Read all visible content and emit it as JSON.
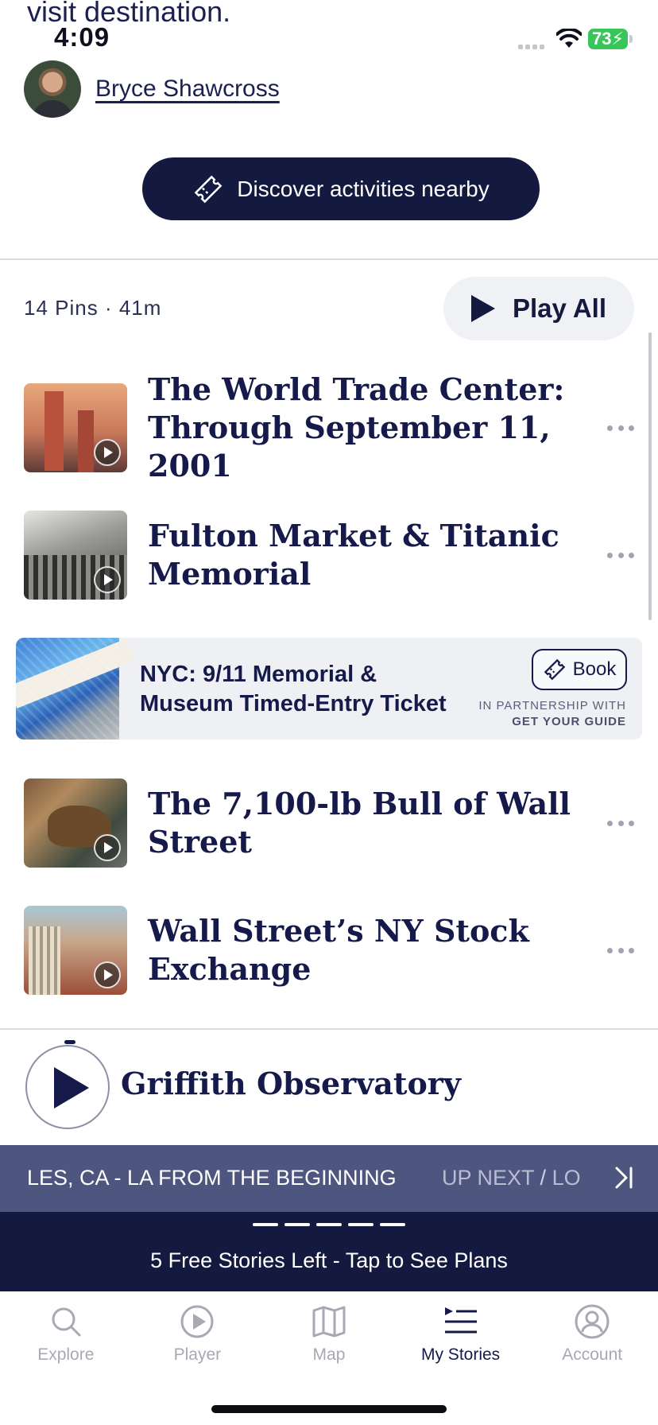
{
  "top_cut_text": "visit destination.",
  "status_bar": {
    "time": "4:09",
    "battery": "73"
  },
  "author": {
    "name": "Bryce Shawcross"
  },
  "discover_button": {
    "label": "Discover activities nearby"
  },
  "playlist": {
    "meta": "14 Pins · 41m",
    "play_all_label": "Play All",
    "pins": [
      {
        "title": "The World Trade Center: Through September 11, 2001"
      },
      {
        "title": "Fulton Market & Titanic Memorial"
      },
      {
        "title": "The 7,100-lb Bull of Wall Street"
      },
      {
        "title": "Wall Street’s NY Stock Exchange"
      }
    ]
  },
  "promo": {
    "title": "NYC: 9/11 Memorial & Museum Timed-Entry Ticket",
    "book_label": "Book",
    "partnership_label": "IN PARTNERSHIP WITH",
    "partner_name": "GET YOUR GUIDE"
  },
  "now_playing": {
    "title": "Griffith Observatory"
  },
  "marquee": {
    "text": "LES, CA - LA FROM THE BEGINNING",
    "up_next": "UP NEXT",
    "up_next_sep": " / ",
    "up_next_rest": "LO"
  },
  "plans_banner": {
    "text": "5 Free Stories Left - Tap to See Plans"
  },
  "tabs": [
    {
      "label": "Explore",
      "icon": "search-icon"
    },
    {
      "label": "Player",
      "icon": "play-circle-icon"
    },
    {
      "label": "Map",
      "icon": "map-icon"
    },
    {
      "label": "My Stories",
      "icon": "playlist-icon",
      "active": true
    },
    {
      "label": "Account",
      "icon": "account-icon"
    }
  ],
  "colors": {
    "navy": "#14193f",
    "accent_slate": "#4e567f",
    "battery_green": "#38c65a"
  }
}
